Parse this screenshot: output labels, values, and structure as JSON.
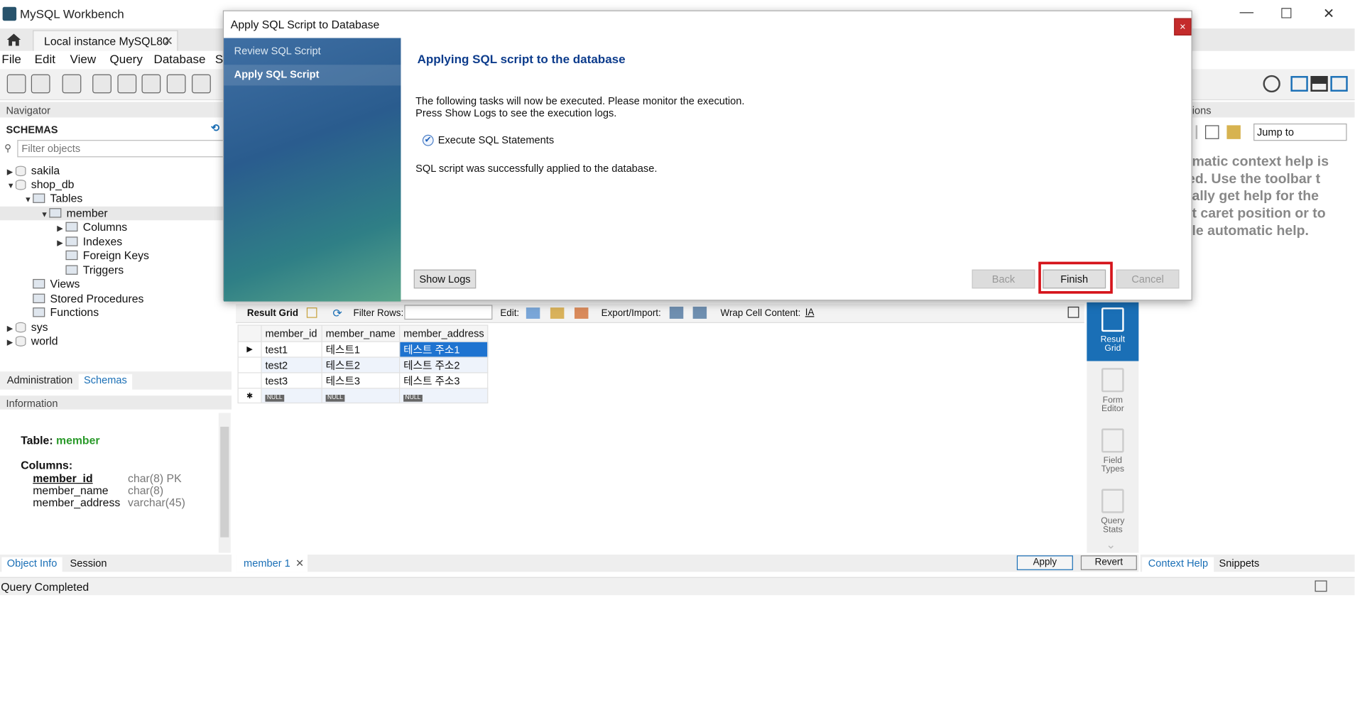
{
  "window": {
    "title": "MySQL Workbench",
    "minimize": "—",
    "maximize": "☐",
    "close": "✕"
  },
  "connection_tab": {
    "label": "Local instance MySQL80",
    "close": "✕"
  },
  "menu": [
    "File",
    "Edit",
    "View",
    "Query",
    "Database",
    "S"
  ],
  "navigator": {
    "header": "Navigator",
    "schemas_label": "SCHEMAS",
    "filter_placeholder": "Filter objects",
    "tree": [
      {
        "label": "sakila"
      },
      {
        "label": "shop_db"
      },
      {
        "label": "Tables"
      },
      {
        "label": "member"
      },
      {
        "label": "Columns"
      },
      {
        "label": "Indexes"
      },
      {
        "label": "Foreign Keys"
      },
      {
        "label": "Triggers"
      },
      {
        "label": "Views"
      },
      {
        "label": "Stored Procedures"
      },
      {
        "label": "Functions"
      },
      {
        "label": "sys"
      },
      {
        "label": "world"
      }
    ],
    "tabs": {
      "administration": "Administration",
      "schemas": "Schemas"
    }
  },
  "information": {
    "header": "Information",
    "table_label": "Table:",
    "table_name": "member",
    "columns_label": "Columns:",
    "columns": [
      {
        "name": "member_id",
        "type": "char(8) PK"
      },
      {
        "name": "member_name",
        "type": "char(8)"
      },
      {
        "name": "member_address",
        "type": "varchar(45)"
      }
    ],
    "tabs": {
      "object_info": "Object Info",
      "session": "Session"
    }
  },
  "result_grid": {
    "label": "Result Grid",
    "filter_rows": "Filter Rows:",
    "edit": "Edit:",
    "export_import": "Export/Import:",
    "wrap": "Wrap Cell Content:",
    "headers": [
      "member_id",
      "member_name",
      "member_address"
    ],
    "rows": [
      [
        "test1",
        "테스트1",
        "테스트 주소1"
      ],
      [
        "test2",
        "테스트2",
        "테스트 주소2"
      ],
      [
        "test3",
        "테스트3",
        "테스트 주소3"
      ]
    ],
    "null_label": "NULL",
    "tab_label": "member 1",
    "apply": "Apply",
    "revert": "Revert"
  },
  "side_panel": [
    {
      "label1": "Result",
      "label2": "Grid"
    },
    {
      "label1": "Form",
      "label2": "Editor"
    },
    {
      "label1": "Field",
      "label2": "Types"
    },
    {
      "label1": "Query",
      "label2": "Stats"
    }
  ],
  "help_panel": {
    "header": "ions",
    "jump_to": "Jump to",
    "text": "omatic context help is\nled. Use the toolbar t\nually get help for the\nnt caret position or to\ngle automatic help.",
    "tabs": {
      "context_help": "Context Help",
      "snippets": "Snippets"
    }
  },
  "status": "Query Completed",
  "dialog": {
    "title": "Apply SQL Script to Database",
    "close": "×",
    "steps": [
      "Review SQL Script",
      "Apply SQL Script"
    ],
    "heading": "Applying SQL script to the database",
    "line1": "The following tasks will now be executed. Please monitor the execution.",
    "line2": "Press Show Logs to see the execution logs.",
    "task": "Execute SQL Statements",
    "result": "SQL script was successfully applied to the database.",
    "show_logs": "Show Logs",
    "back": "Back",
    "finish": "Finish",
    "cancel": "Cancel"
  }
}
